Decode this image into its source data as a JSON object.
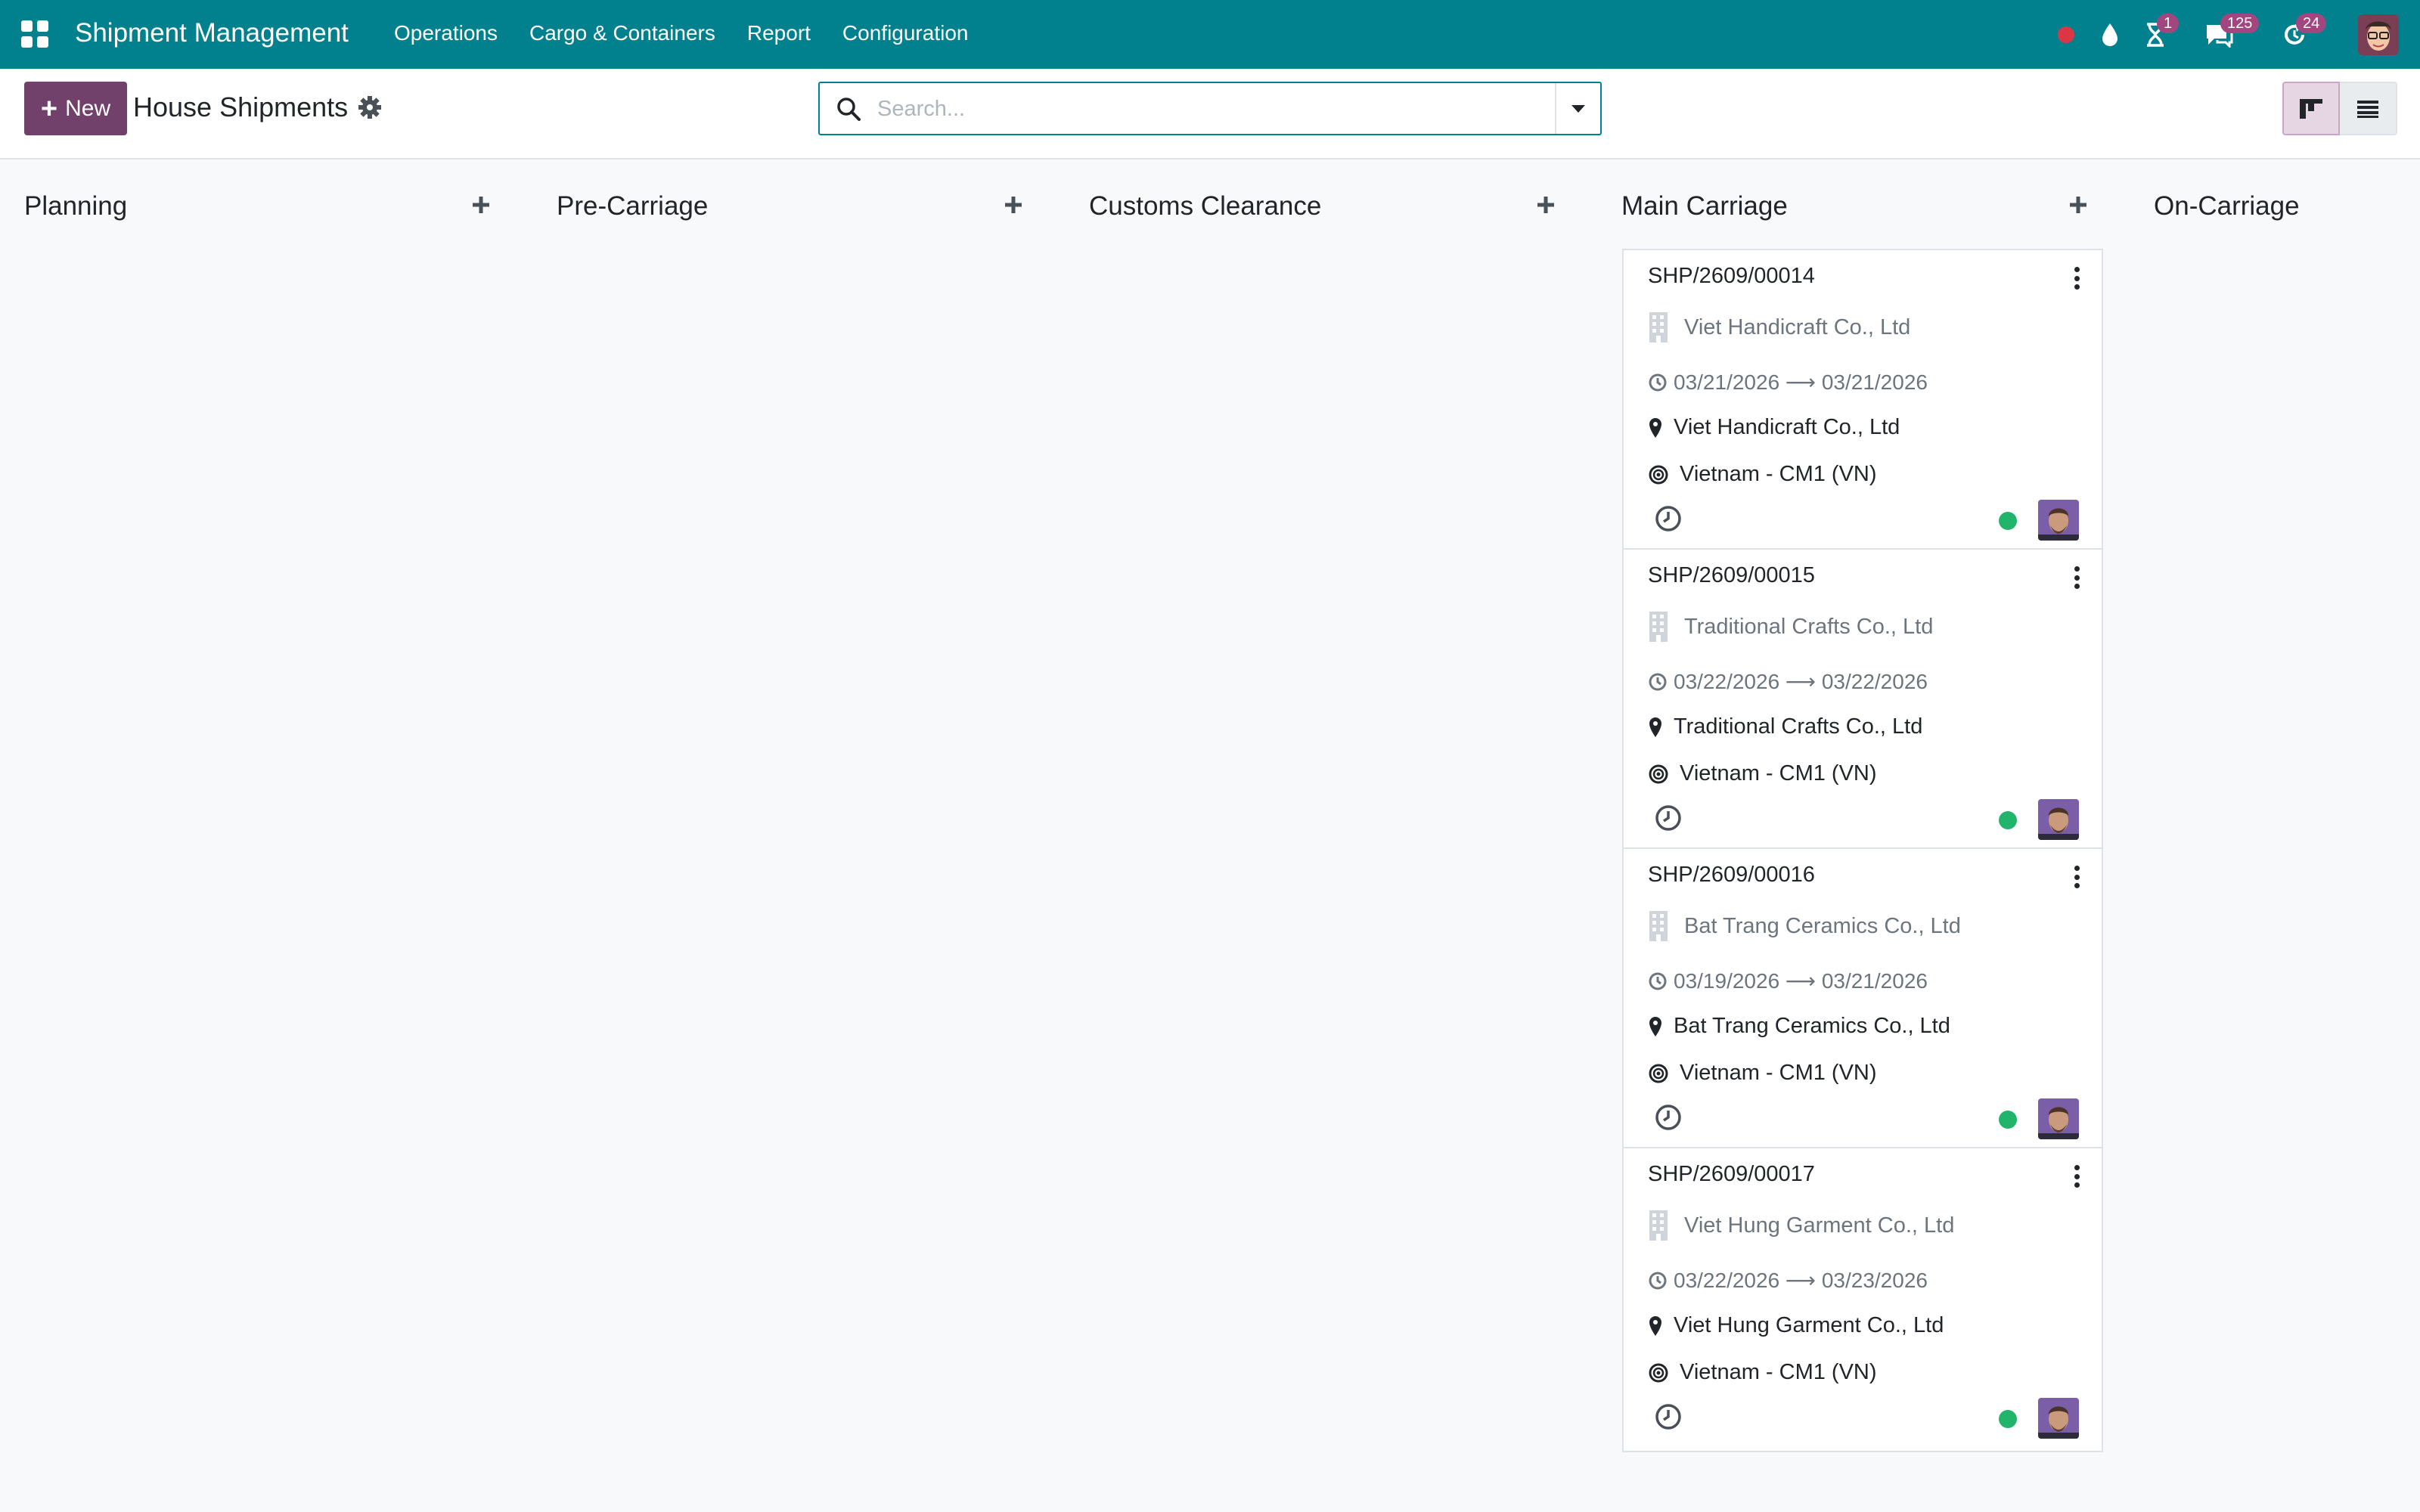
{
  "app": {
    "brand": "Shipment Management",
    "menu": [
      "Operations",
      "Cargo & Containers",
      "Report",
      "Configuration"
    ]
  },
  "systray": {
    "activity_badge": "1",
    "messages_badge": "125",
    "updates_badge": "24"
  },
  "control": {
    "new_label": "New",
    "title": "House Shipments",
    "search_placeholder": "Search..."
  },
  "columns": [
    {
      "name": "Planning"
    },
    {
      "name": "Pre-Carriage"
    },
    {
      "name": "Customs Clearance"
    },
    {
      "name": "Main Carriage"
    },
    {
      "name": "On-Carriage"
    }
  ],
  "cards": [
    {
      "ref": "SHP/2609/00014",
      "partner": "Viet Handicraft Co., Ltd",
      "date_range": "03/21/2026 ⟶ 03/21/2026",
      "location": "Viet Handicraft Co., Ltd",
      "port": "Vietnam - CM1 (VN)",
      "status_color": "#21b56b"
    },
    {
      "ref": "SHP/2609/00015",
      "partner": "Traditional Crafts Co., Ltd",
      "date_range": "03/22/2026 ⟶ 03/22/2026",
      "location": "Traditional Crafts Co., Ltd",
      "port": "Vietnam - CM1 (VN)",
      "status_color": "#21b56b"
    },
    {
      "ref": "SHP/2609/00016",
      "partner": "Bat Trang Ceramics Co., Ltd",
      "date_range": "03/19/2026 ⟶ 03/21/2026",
      "location": "Bat Trang Ceramics Co., Ltd",
      "port": "Vietnam - CM1 (VN)",
      "status_color": "#21b56b"
    },
    {
      "ref": "SHP/2609/00017",
      "partner": "Viet Hung Garment Co., Ltd",
      "date_range": "03/22/2026 ⟶ 03/23/2026",
      "location": "Viet Hung Garment Co., Ltd",
      "port": "Vietnam - CM1 (VN)",
      "status_color": "#21b56b"
    }
  ],
  "colors": {
    "navbar": "#01818e",
    "primary": "#71406b",
    "badge": "#a2467f",
    "status_ok": "#21b56b",
    "status_blocked": "#dc3545"
  }
}
